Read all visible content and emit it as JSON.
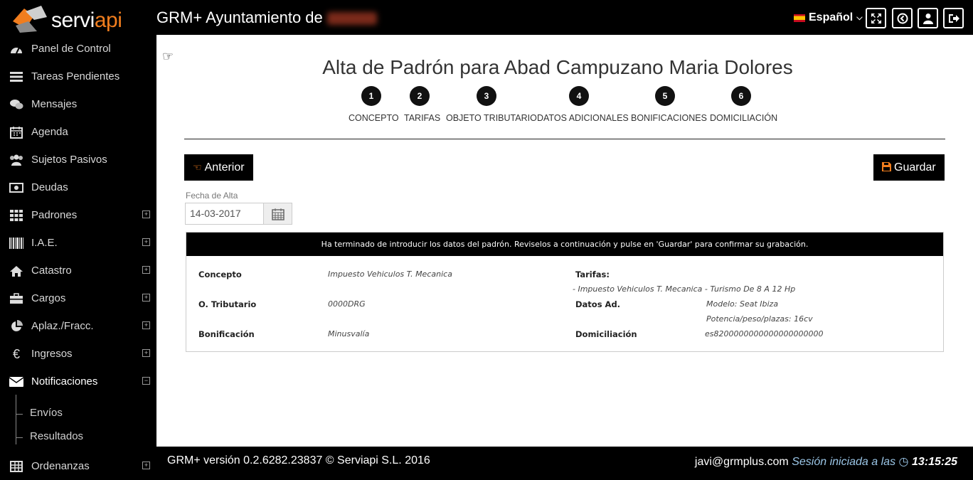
{
  "app": {
    "brand_main": "servi",
    "brand_accent": "api",
    "title": "GRM+ Ayuntamiento de"
  },
  "topbar": {
    "language": "Español",
    "icons": [
      "expand-icon",
      "back-circle-icon",
      "user-icon",
      "logout-icon"
    ]
  },
  "sidebar": {
    "items": [
      {
        "label": "Panel de Control",
        "icon": "dashboard-icon",
        "expandable": false
      },
      {
        "label": "Tareas Pendientes",
        "icon": "tasks-icon",
        "expandable": false
      },
      {
        "label": "Mensajes",
        "icon": "chat-icon",
        "expandable": false
      },
      {
        "label": "Agenda",
        "icon": "calendar-icon",
        "expandable": false
      },
      {
        "label": "Sujetos Pasivos",
        "icon": "users-icon",
        "expandable": false
      },
      {
        "label": "Deudas",
        "icon": "money-icon",
        "expandable": false
      },
      {
        "label": "Padrones",
        "icon": "grid-icon",
        "expandable": true
      },
      {
        "label": "I.A.E.",
        "icon": "barcode-icon",
        "expandable": true
      },
      {
        "label": "Catastro",
        "icon": "home-icon",
        "expandable": true
      },
      {
        "label": "Cargos",
        "icon": "briefcase-icon",
        "expandable": true
      },
      {
        "label": "Aplaz./Fracc.",
        "icon": "pie-icon",
        "expandable": true
      },
      {
        "label": "Ingresos",
        "icon": "euro-icon",
        "expandable": true
      },
      {
        "label": "Notificaciones",
        "icon": "envelope-icon",
        "expandable": true,
        "expanded": true
      },
      {
        "label": "Ordenanzas",
        "icon": "table-icon",
        "expandable": true
      }
    ],
    "subitems": [
      "Envíos",
      "Resultados"
    ]
  },
  "main": {
    "heading": "Alta de Padrón para Abad Campuzano Maria Dolores",
    "steps": [
      {
        "num": "1",
        "label": "CONCEPTO"
      },
      {
        "num": "2",
        "label": "TARIFAS"
      },
      {
        "num": "3",
        "label": "OBJETO TRIBUTARIO"
      },
      {
        "num": "4",
        "label": "DATOS ADICIONALES"
      },
      {
        "num": "5",
        "label": "BONIFICACIONES"
      },
      {
        "num": "6",
        "label": "DOMICILIACIÓN"
      }
    ],
    "prev_label": "Anterior",
    "save_label": "Guardar",
    "fecha_label": "Fecha de Alta",
    "fecha_value": "14-03-2017",
    "banner": "Ha terminado de introducir los datos del padrón. Reviselos a continuación y pulse en 'Guardar' para confirmar su grabación.",
    "summary": {
      "concepto_k": "Concepto",
      "concepto_v": "Impuesto Vehiculos T. Mecanica",
      "tarifas_k": "Tarifas:",
      "tarifas_v": "- Impuesto Vehiculos T. Mecanica - Turismo De 8 A 12 Hp",
      "otrib_k": "O. Tributario",
      "otrib_v": "0000DRG",
      "datos_k": "Datos Ad.",
      "datos_v1": "Modelo: Seat Ibiza",
      "datos_v2": "Potencia/peso/plazas: 16cv",
      "bonif_k": "Bonificación",
      "bonif_v": "Minusvalía",
      "domic_k": "Domiciliación",
      "domic_v": "es8200000000000000000000"
    }
  },
  "footer": {
    "version": "GRM+ versión 0.2.6282.23837 © Serviapi S.L. 2016",
    "email": "javi@grmplus.com",
    "session_label": "Sesión iniciada a las",
    "time": "13:15:25"
  }
}
